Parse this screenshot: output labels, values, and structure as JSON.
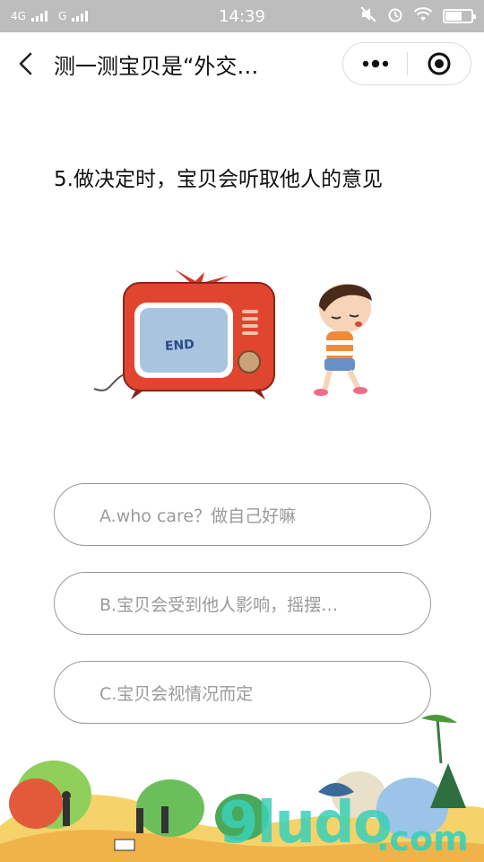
{
  "status_bar": {
    "network_1": "4G",
    "network_2": "G",
    "time": "14:39"
  },
  "nav": {
    "title": "测一测宝贝是“外交…",
    "icons": [
      "back-icon",
      "more-icon",
      "close-target-icon"
    ]
  },
  "question": {
    "text": "5.做决定时，宝贝会听取他人的意见"
  },
  "illustration": {
    "tv_screen_text": "END"
  },
  "options": [
    {
      "label": "A.who care？做自己好嘛"
    },
    {
      "label": "B.宝贝会受到他人影响，摇摆…"
    },
    {
      "label": "C.宝贝会视情况而定"
    }
  ],
  "watermark": {
    "main": "9ludo",
    "suffix": ".com"
  },
  "colors": {
    "status_bar_bg": "#bdbdbd",
    "option_border": "#999999",
    "option_text": "#9a9a9a",
    "watermark": "#3ad0b8"
  }
}
